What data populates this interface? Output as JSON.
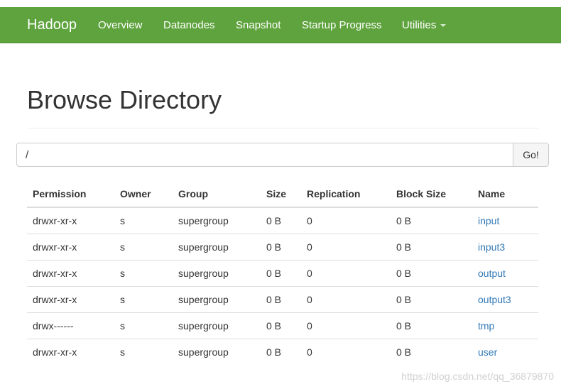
{
  "navbar": {
    "brand": "Hadoop",
    "items": [
      {
        "label": "Overview"
      },
      {
        "label": "Datanodes"
      },
      {
        "label": "Snapshot"
      },
      {
        "label": "Startup Progress"
      },
      {
        "label": "Utilities",
        "has_dropdown": true
      }
    ]
  },
  "page": {
    "title": "Browse Directory"
  },
  "path_bar": {
    "value": "/",
    "go_label": "Go!"
  },
  "table": {
    "headers": [
      "Permission",
      "Owner",
      "Group",
      "Size",
      "Replication",
      "Block Size",
      "Name"
    ],
    "rows": [
      {
        "permission": "drwxr-xr-x",
        "owner": "s",
        "group": "supergroup",
        "size": "0 B",
        "replication": "0",
        "block_size": "0 B",
        "name": "input"
      },
      {
        "permission": "drwxr-xr-x",
        "owner": "s",
        "group": "supergroup",
        "size": "0 B",
        "replication": "0",
        "block_size": "0 B",
        "name": "input3"
      },
      {
        "permission": "drwxr-xr-x",
        "owner": "s",
        "group": "supergroup",
        "size": "0 B",
        "replication": "0",
        "block_size": "0 B",
        "name": "output"
      },
      {
        "permission": "drwxr-xr-x",
        "owner": "s",
        "group": "supergroup",
        "size": "0 B",
        "replication": "0",
        "block_size": "0 B",
        "name": "output3"
      },
      {
        "permission": "drwx------",
        "owner": "s",
        "group": "supergroup",
        "size": "0 B",
        "replication": "0",
        "block_size": "0 B",
        "name": "tmp"
      },
      {
        "permission": "drwxr-xr-x",
        "owner": "s",
        "group": "supergroup",
        "size": "0 B",
        "replication": "0",
        "block_size": "0 B",
        "name": "user"
      }
    ]
  },
  "watermark": "https://blog.csdn.net/qq_36879870",
  "colors": {
    "navbar_bg": "#5fa33e",
    "link": "#337ab7"
  }
}
